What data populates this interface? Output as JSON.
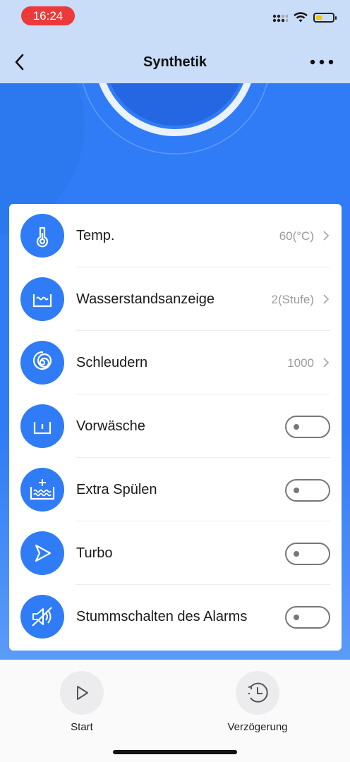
{
  "status_bar": {
    "time": "16:24",
    "time_pill_color": "#ec3a3a",
    "icons": [
      "signal-icon",
      "wifi-icon",
      "battery-icon"
    ]
  },
  "header": {
    "title": "Synthetik",
    "back_icon": "chevron-left-icon",
    "more_icon": "more-icon"
  },
  "colors": {
    "accent": "#2f7cf6",
    "header_bg": "#c9dcf8",
    "toggle_off": "#777777"
  },
  "settings": [
    {
      "id": "temp",
      "label": "Temp.",
      "value": "60(°C)",
      "icon": "thermometer-icon",
      "type": "select"
    },
    {
      "id": "water",
      "label": "Wasserstandsanzeige",
      "value": "2(Stufe)",
      "icon": "water-level-icon",
      "type": "select"
    },
    {
      "id": "spin",
      "label": "Schleudern",
      "value": "1000",
      "icon": "spin-icon",
      "type": "select"
    },
    {
      "id": "prewash",
      "label": "Vorwäsche",
      "icon": "prewash-icon",
      "type": "toggle",
      "on": false
    },
    {
      "id": "extra_rinse",
      "label": "Extra Spülen",
      "icon": "extra-rinse-icon",
      "type": "toggle",
      "on": false
    },
    {
      "id": "turbo",
      "label": "Turbo",
      "icon": "turbo-icon",
      "type": "toggle",
      "on": false
    },
    {
      "id": "mute",
      "label": "Stummschalten des Alarms",
      "icon": "mute-icon",
      "type": "toggle",
      "on": false
    }
  ],
  "bottom": {
    "start_label": "Start",
    "delay_label": "Verzögerung",
    "start_icon": "play-icon",
    "delay_icon": "clock-icon"
  }
}
